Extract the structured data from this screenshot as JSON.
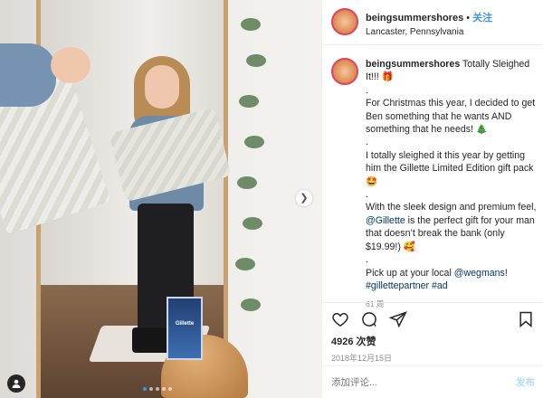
{
  "header": {
    "username": "beingsummershores",
    "separator": " • ",
    "follow_label": "关注",
    "location": "Lancaster, Pennsylvania"
  },
  "caption": {
    "username": "beingsummershores",
    "lines": [
      "Totally Sleighed It!!! 🎁",
      ".",
      "For Christmas this year, I decided to get Ben something that he wants AND something that he needs! 🎄",
      ".",
      "I totally sleighed it this year by getting him the Gillette Limited Edition gift pack 🤩",
      ".",
      "With the sleek design and premium feel, ",
      "@Gillette",
      " is the perfect gift for your man that doesn’t break the bank (only $19.99!) 🥰",
      ".",
      "Pick up at your local ",
      "@wegmans",
      "!",
      "#gillettepartner #ad"
    ],
    "age": "61 周"
  },
  "photo": {
    "product_label": "Gillette",
    "carousel_dots": 5,
    "active_dot": 0
  },
  "stats": {
    "likes": "4926 次赞",
    "date": "2018年12月15日"
  },
  "icons": {
    "like": "heart-icon",
    "comment": "comment-icon",
    "share": "share-icon",
    "save": "bookmark-icon",
    "next": "chevron-right-icon",
    "user_tag": "person-icon"
  },
  "comment": {
    "placeholder": "添加评论...",
    "post_label": "发布"
  },
  "colors": {
    "link": "#00376b",
    "follow": "#3897f0",
    "muted": "#8e8e8e",
    "post_disabled": "#b3dbff"
  }
}
